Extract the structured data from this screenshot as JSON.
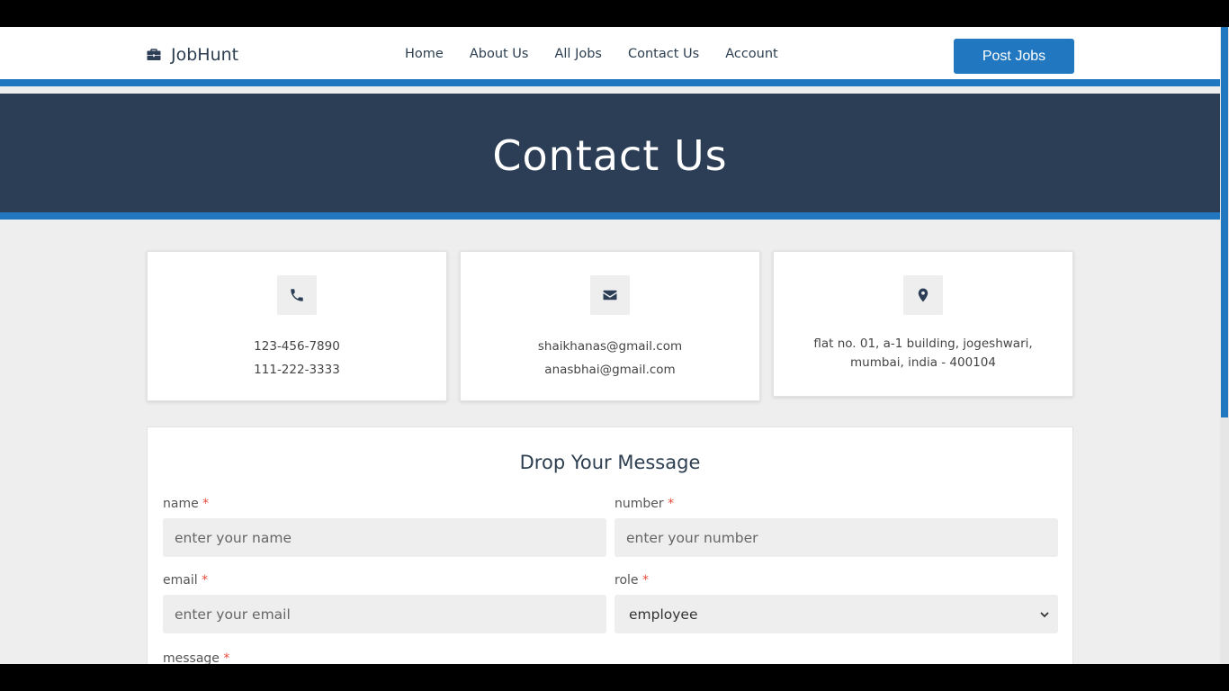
{
  "header": {
    "logo_text": "JobHunt",
    "logo_icon": "briefcase-icon",
    "nav": [
      {
        "label": "Home"
      },
      {
        "label": "About Us"
      },
      {
        "label": "All Jobs"
      },
      {
        "label": "Contact Us"
      },
      {
        "label": "Account"
      }
    ],
    "post_button": "Post Jobs"
  },
  "hero": {
    "title": "Contact Us"
  },
  "cards": {
    "phone": {
      "icon": "phone-icon",
      "line1": "123-456-7890",
      "line2": "111-222-3333"
    },
    "email": {
      "icon": "envelope-icon",
      "line1": "shaikhanas@gmail.com",
      "line2": "anasbhai@gmail.com"
    },
    "address": {
      "icon": "map-marker-icon",
      "text": "flat no. 01, a-1 building, jogeshwari, mumbai, india - 400104"
    }
  },
  "form": {
    "title": "Drop Your Message",
    "name": {
      "label": "name",
      "placeholder": "enter your name"
    },
    "number": {
      "label": "number",
      "placeholder": "enter your number"
    },
    "email": {
      "label": "email",
      "placeholder": "enter your email"
    },
    "role": {
      "label": "role",
      "value": "employee"
    },
    "message": {
      "label": "message"
    },
    "required_mark": "*"
  },
  "colors": {
    "accent": "#2278c0",
    "hero_bg": "#2c3e55",
    "required": "#e74c3c"
  }
}
